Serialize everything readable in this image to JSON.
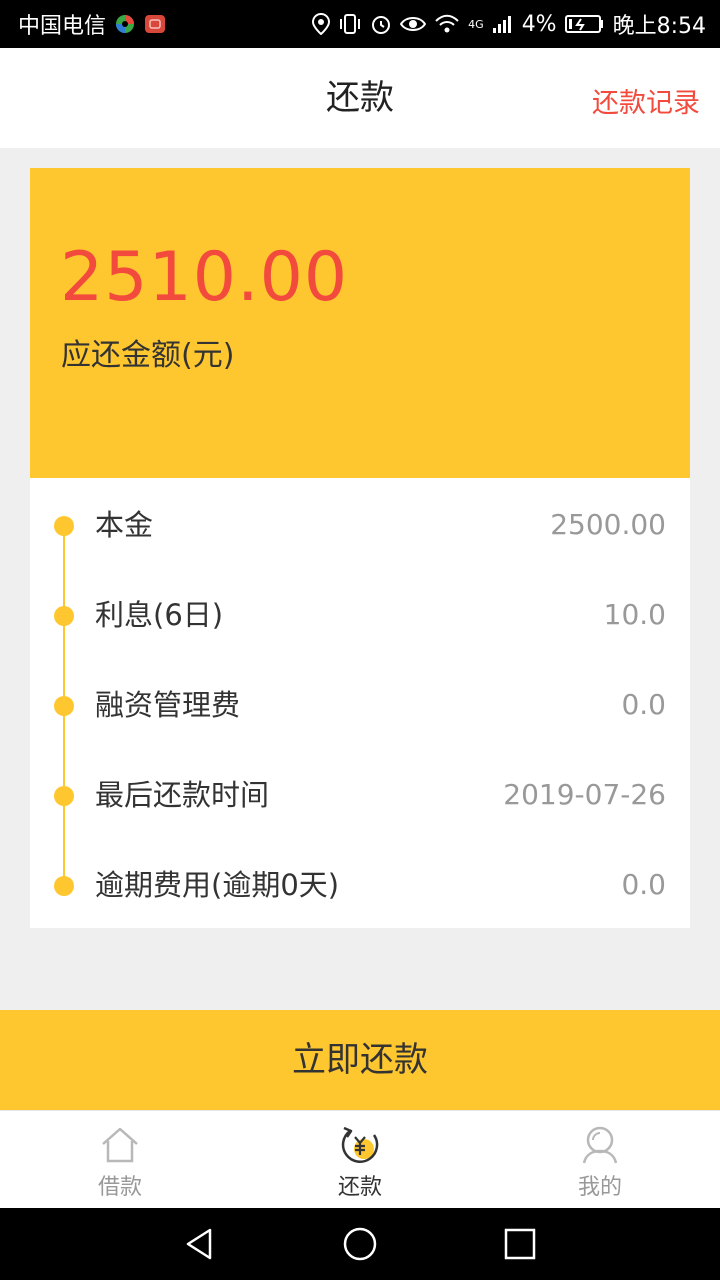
{
  "status_bar": {
    "carrier": "中国电信",
    "network": "4G",
    "battery_percent": "4%",
    "time": "晚上8:54"
  },
  "header": {
    "title": "还款",
    "action_label": "还款记录"
  },
  "summary": {
    "amount": "2510.00",
    "amount_label": "应还金额(元)"
  },
  "details": [
    {
      "label": "本金",
      "value": "2500.00"
    },
    {
      "label": "利息(6日)",
      "value": "10.0"
    },
    {
      "label": "融资管理费",
      "value": "0.0"
    },
    {
      "label": "最后还款时间",
      "value": "2019-07-26"
    },
    {
      "label": "逾期费用(逾期0天)",
      "value": "0.0"
    }
  ],
  "pay_button_label": "立即还款",
  "bottom_nav": {
    "items": [
      {
        "label": "借款",
        "icon": "home-icon",
        "active": false
      },
      {
        "label": "还款",
        "icon": "repay-icon",
        "active": true
      },
      {
        "label": "我的",
        "icon": "user-icon",
        "active": false
      }
    ]
  },
  "colors": {
    "accent_yellow": "#ffc72f",
    "accent_red": "#f24b3e",
    "background": "#efefef"
  }
}
